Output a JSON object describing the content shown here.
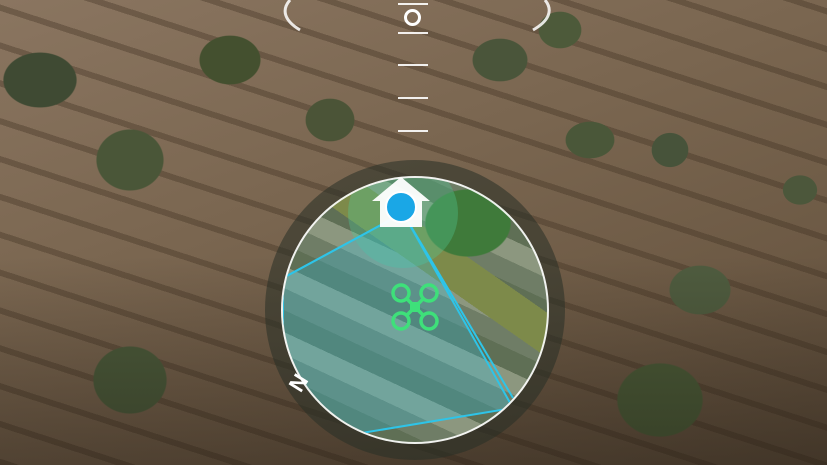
{
  "viewport": {
    "scene": "aerial-drone-view"
  },
  "gimbal_indicator": {
    "icon": "gimbal-pitch-ring-icon"
  },
  "minimap": {
    "north_label": "N",
    "home_icon": "home-point-icon",
    "pilot_icon": "pilot-location-icon",
    "aircraft_icon": "drone-aircraft-icon",
    "colors": {
      "home": "#ffffff",
      "pilot": "#1aa7e6",
      "aircraft": "#3ee07a",
      "fov": "#2ec4e8"
    }
  }
}
